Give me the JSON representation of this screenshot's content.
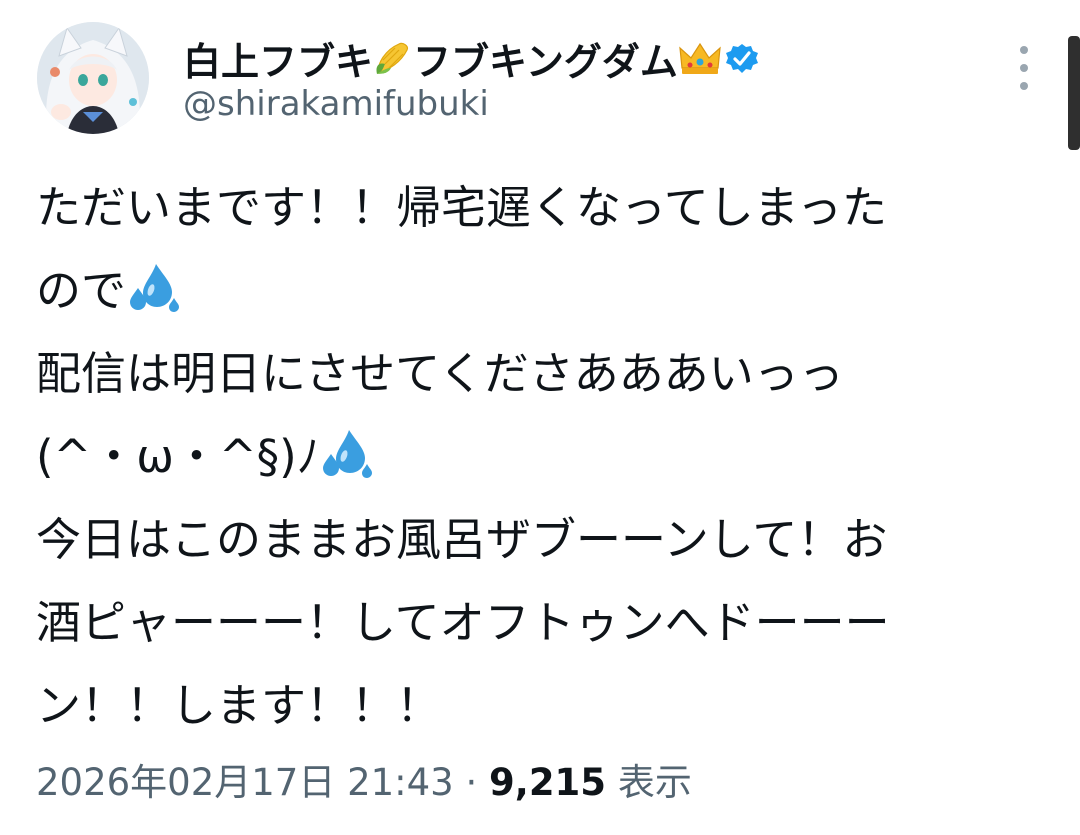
{
  "author": {
    "display_name_part1": "白上フブキ",
    "display_name_part2": "フブキングダム",
    "name_emoji_1": "corn-emoji",
    "name_emoji_2": "crown-emoji",
    "verified": true,
    "handle": "@shirakamifubuki"
  },
  "tweet": {
    "lines": [
      {
        "text": "ただいまです！！帰宅遅くなってしまった",
        "emoji": ""
      },
      {
        "text": "ので",
        "emoji": "sweat-droplets-emoji"
      },
      {
        "text": "配信は明日にさせてくださあああいっっ",
        "emoji": ""
      },
      {
        "text": "(^・ω・^§)ﾉ",
        "emoji": "sweat-droplets-emoji"
      },
      {
        "text": "今日はこのままお風呂ザブーーンして！お",
        "emoji": ""
      },
      {
        "text": "酒ピャーーー！してオフトゥンへドーーー",
        "emoji": ""
      },
      {
        "text": "ン！！します！！！",
        "emoji": ""
      }
    ],
    "timestamp": "2026年02月17日 21:43",
    "separator": " · ",
    "views_count": "9,215",
    "views_label": " 表示"
  },
  "colors": {
    "text_primary": "#0f1419",
    "text_secondary": "#536471",
    "verified_blue": "#1d9bf0",
    "sweat_blue": "#3a9ee0"
  }
}
